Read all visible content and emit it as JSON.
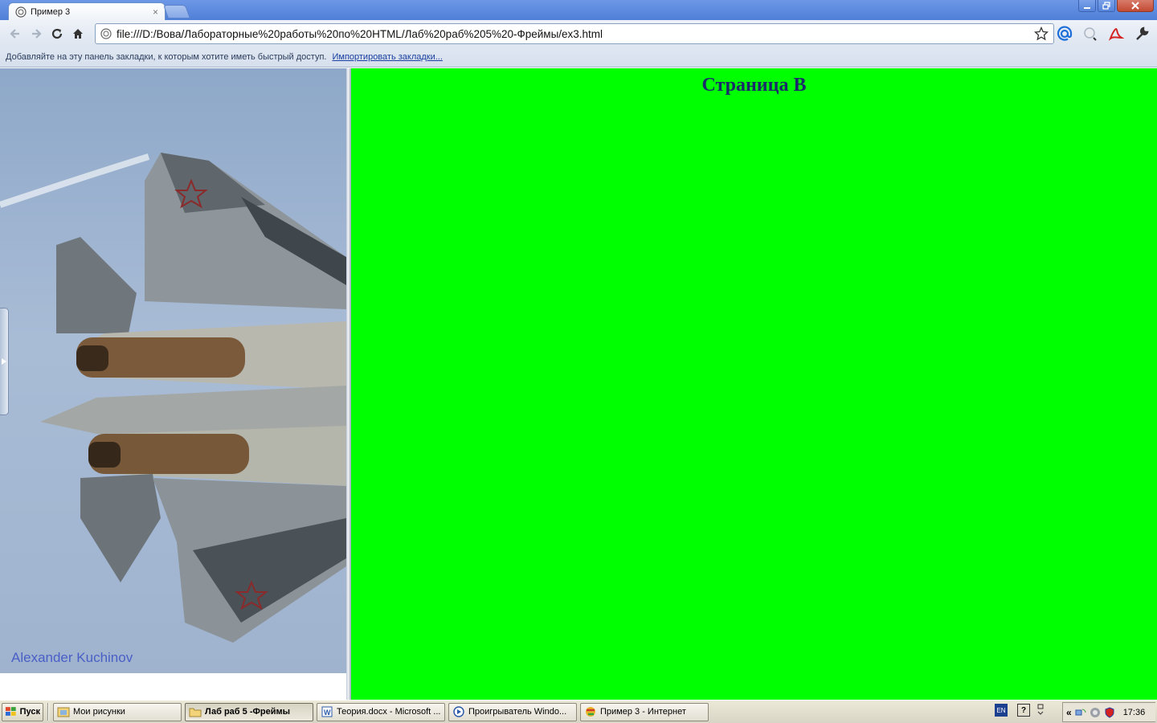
{
  "browser": {
    "tab_title": "Пример 3",
    "tab_close": "×",
    "url": "file:///D:/Вова/Лабораторные%20работы%20по%20HTML/Лаб%20раб%205%20-Фреймы/ex3.html",
    "bookmark_bar_text": "Добавляйте на эту панель закладки, к которым хотите иметь быстрый доступ.",
    "bookmark_import_link": "Импортировать закладки..."
  },
  "frames": {
    "left": {
      "photo_credit": "Alexander Kuchinov"
    },
    "right": {
      "heading": "Страница B",
      "background": "#00ff00"
    }
  },
  "taskbar": {
    "start_label": "Пуск",
    "tasks": [
      {
        "label": "Мои рисунки",
        "active": false
      },
      {
        "label": "Лаб раб 5 -Фреймы",
        "active": true
      },
      {
        "label": "Теория.docx - Microsoft ...",
        "active": false
      },
      {
        "label": "Проигрыватель Windo...",
        "active": false
      },
      {
        "label": "Пример 3 - Интернет",
        "active": false
      }
    ],
    "language": "EN",
    "help": "?",
    "tray_chevron": "«",
    "clock": "17:36"
  }
}
